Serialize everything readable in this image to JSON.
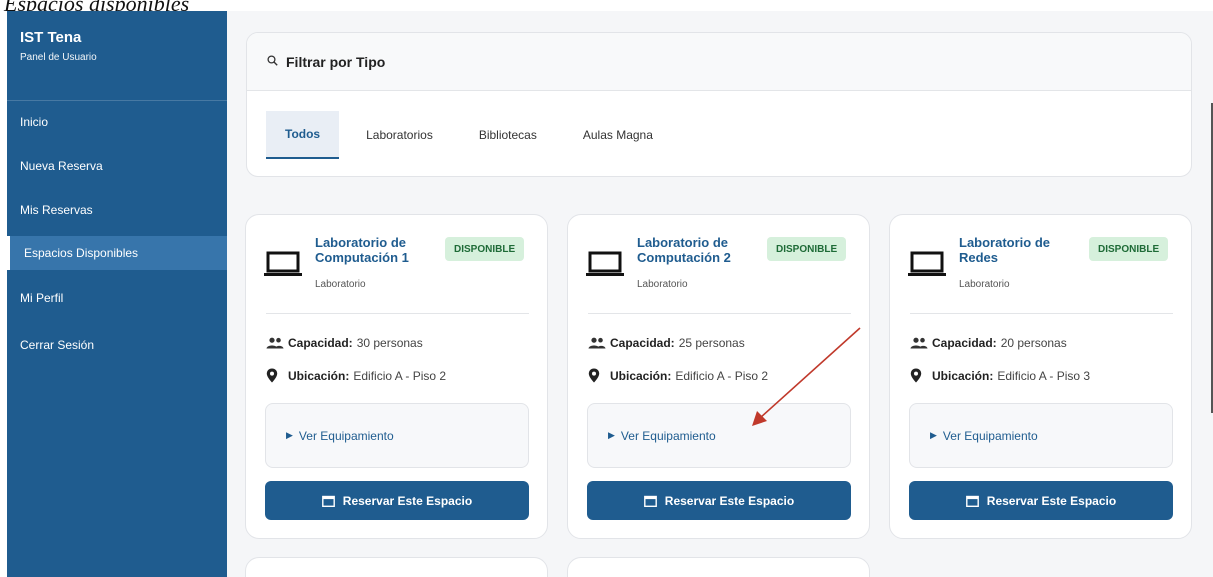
{
  "caption": "Espacios disponibles",
  "sidebar": {
    "brand_title": "IST Tena",
    "brand_subtitle": "Panel de Usuario",
    "items": [
      {
        "label": "Inicio"
      },
      {
        "label": "Nueva Reserva"
      },
      {
        "label": "Mis Reservas"
      },
      {
        "label": "Espacios Disponibles",
        "active": true
      },
      {
        "label": "Mi Perfil"
      },
      {
        "label": "Cerrar Sesión"
      }
    ]
  },
  "filter": {
    "icon": "search-icon",
    "title": "Filtrar por Tipo",
    "tabs": [
      {
        "label": "Todos",
        "active": true
      },
      {
        "label": "Laboratorios"
      },
      {
        "label": "Bibliotecas"
      },
      {
        "label": "Aulas Magna"
      }
    ]
  },
  "cards": [
    {
      "title": "Laboratorio de Computación 1",
      "status": "DISPONIBLE",
      "type": "Laboratorio",
      "capacity_label": "Capacidad:",
      "capacity_value": "30 personas",
      "location_label": "Ubicación:",
      "location_value": "Edificio A - Piso 2",
      "equipment_label": "Ver Equipamiento",
      "reserve_label": "Reservar Este Espacio"
    },
    {
      "title": "Laboratorio de Computación 2",
      "status": "DISPONIBLE",
      "type": "Laboratorio",
      "capacity_label": "Capacidad:",
      "capacity_value": "25 personas",
      "location_label": "Ubicación:",
      "location_value": "Edificio A - Piso 2",
      "equipment_label": "Ver Equipamiento",
      "reserve_label": "Reservar Este Espacio"
    },
    {
      "title": "Laboratorio de Redes",
      "status": "DISPONIBLE",
      "type": "Laboratorio",
      "capacity_label": "Capacidad:",
      "capacity_value": "20 personas",
      "location_label": "Ubicación:",
      "location_value": "Edificio A - Piso 3",
      "equipment_label": "Ver Equipamiento",
      "reserve_label": "Reservar Este Espacio"
    }
  ],
  "colors": {
    "sidebar_bg": "#1f5c8f",
    "sidebar_active": "#3775ab",
    "status_badge_bg": "#d6f0dc",
    "status_badge_text": "#1e6b37",
    "annotation_arrow": "#c0392b"
  }
}
